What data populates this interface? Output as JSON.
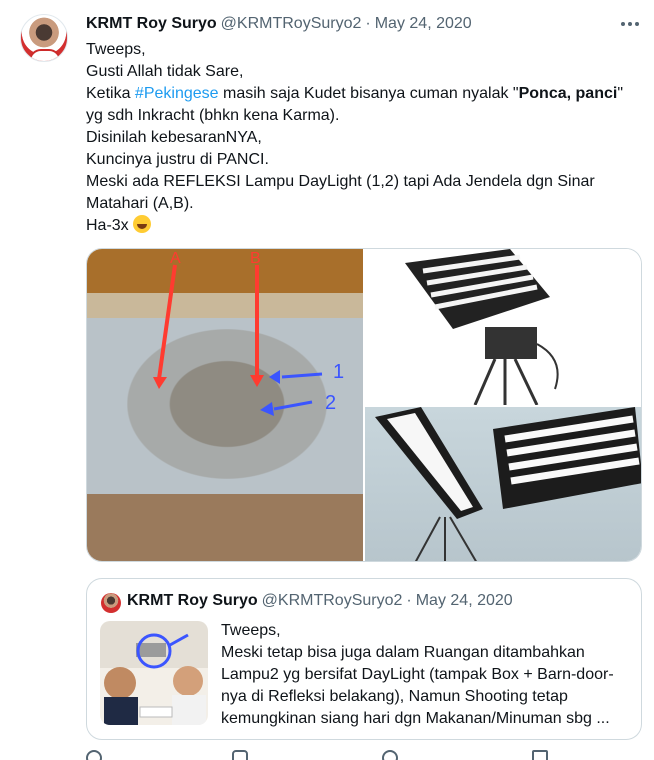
{
  "tweet": {
    "display_name": "KRMT Roy Suryo",
    "handle": "@KRMTRoySuryo2",
    "separator": "·",
    "date": "May 24, 2020",
    "lines": {
      "l1": "Tweeps,",
      "l2": "Gusti Allah tidak Sare,",
      "l3_pre": "Ketika ",
      "l3_hashtag": "#Pekingese",
      "l3_mid": " masih saja Kudet bisanya cuman nyalak \"",
      "l3_bold": "Ponca, panci",
      "l3_post": "\"",
      "l4": "yg sdh Inkracht (bhkn kena Karma).",
      "l5": "Disinilah kebesaranNYA,",
      "l6": "Kuncinya justru di PANCI.",
      "l7": "Meski ada REFLEKSI Lampu DayLight (1,2) tapi Ada Jendela dgn Sinar",
      "l8": "Matahari (A,B).",
      "l9": "Ha-3x"
    },
    "emoji": "rolling-on-floor-laughing-emoji",
    "media_labels": {
      "a": "A",
      "b": "B",
      "one": "1",
      "two": "2"
    }
  },
  "quote": {
    "display_name": "KRMT Roy Suryo",
    "handle": "@KRMTRoySuryo2",
    "separator": "·",
    "date": "May 24, 2020",
    "lines": [
      "Tweeps,",
      "Meski tetap bisa juga dalam Ruangan ditambahkan",
      "Lampu2 yg bersifat DayLight (tampak Box + Barn-door-",
      "nya di Refleksi belakang), Namun Shooting tetap",
      "kemungkinan siang hari dgn Makanan/Minuman sbg ..."
    ]
  },
  "colors": {
    "link": "#1d9bf0",
    "text": "#0f1419",
    "muted": "#536471",
    "arrow_red": "#ff3b30",
    "arrow_blue": "#3b55ff",
    "border": "#cfd9de"
  }
}
